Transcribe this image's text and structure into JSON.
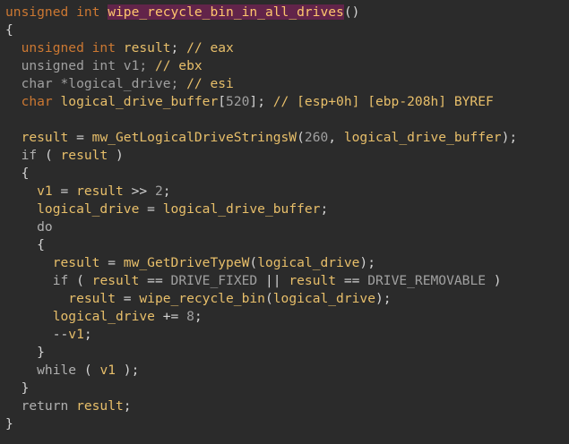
{
  "code": {
    "lines": [
      [
        {
          "t": "unsigned int ",
          "c": "type"
        },
        {
          "t": "wipe_recycle_bin_in_all_drives",
          "c": "func-hl"
        },
        {
          "t": "()",
          "c": "punct"
        }
      ],
      [
        {
          "t": "{",
          "c": "brace"
        }
      ],
      [
        {
          "t": "  unsigned int ",
          "c": "type"
        },
        {
          "t": "result",
          "c": "var"
        },
        {
          "t": "; ",
          "c": "punct"
        },
        {
          "t": "// eax",
          "c": "comment"
        }
      ],
      [
        {
          "t": "  unsigned int ",
          "c": "dim"
        },
        {
          "t": "v1",
          "c": "dim"
        },
        {
          "t": "; ",
          "c": "dim"
        },
        {
          "t": "// ebx",
          "c": "comment"
        }
      ],
      [
        {
          "t": "  char ",
          "c": "dim"
        },
        {
          "t": "*logical_drive",
          "c": "dim"
        },
        {
          "t": "; ",
          "c": "dim"
        },
        {
          "t": "// esi",
          "c": "comment"
        }
      ],
      [
        {
          "t": "  char ",
          "c": "type"
        },
        {
          "t": "logical_drive_buffer",
          "c": "var"
        },
        {
          "t": "[",
          "c": "punct"
        },
        {
          "t": "520",
          "c": "num"
        },
        {
          "t": "]; ",
          "c": "punct"
        },
        {
          "t": "// [esp+0h] [ebp-208h] BYREF",
          "c": "comment"
        }
      ],
      [],
      [
        {
          "t": "  result",
          "c": "var"
        },
        {
          "t": " = ",
          "c": "punct"
        },
        {
          "t": "mw_GetLogicalDriveStringsW",
          "c": "func"
        },
        {
          "t": "(",
          "c": "punct"
        },
        {
          "t": "260",
          "c": "num"
        },
        {
          "t": ", ",
          "c": "punct"
        },
        {
          "t": "logical_drive_buffer",
          "c": "var"
        },
        {
          "t": ");",
          "c": "punct"
        }
      ],
      [
        {
          "t": "  if",
          "c": "kw"
        },
        {
          "t": " ( ",
          "c": "punct"
        },
        {
          "t": "result",
          "c": "var"
        },
        {
          "t": " )",
          "c": "punct"
        }
      ],
      [
        {
          "t": "  {",
          "c": "brace"
        }
      ],
      [
        {
          "t": "    v1",
          "c": "var"
        },
        {
          "t": " = ",
          "c": "punct"
        },
        {
          "t": "result",
          "c": "var"
        },
        {
          "t": " >> ",
          "c": "punct"
        },
        {
          "t": "2",
          "c": "num"
        },
        {
          "t": ";",
          "c": "punct"
        }
      ],
      [
        {
          "t": "    logical_drive",
          "c": "var"
        },
        {
          "t": " = ",
          "c": "punct"
        },
        {
          "t": "logical_drive_buffer",
          "c": "var"
        },
        {
          "t": ";",
          "c": "punct"
        }
      ],
      [
        {
          "t": "    do",
          "c": "kw"
        }
      ],
      [
        {
          "t": "    {",
          "c": "brace"
        }
      ],
      [
        {
          "t": "      result",
          "c": "var"
        },
        {
          "t": " = ",
          "c": "punct"
        },
        {
          "t": "mw_GetDriveTypeW",
          "c": "func"
        },
        {
          "t": "(",
          "c": "punct"
        },
        {
          "t": "logical_drive",
          "c": "var"
        },
        {
          "t": ");",
          "c": "punct"
        }
      ],
      [
        {
          "t": "      if",
          "c": "kw"
        },
        {
          "t": " ( ",
          "c": "punct"
        },
        {
          "t": "result",
          "c": "var"
        },
        {
          "t": " == ",
          "c": "punct"
        },
        {
          "t": "DRIVE_FIXED",
          "c": "const"
        },
        {
          "t": " || ",
          "c": "punct"
        },
        {
          "t": "result",
          "c": "var"
        },
        {
          "t": " == ",
          "c": "punct"
        },
        {
          "t": "DRIVE_REMOVABLE",
          "c": "const"
        },
        {
          "t": " )",
          "c": "punct"
        }
      ],
      [
        {
          "t": "        result",
          "c": "var"
        },
        {
          "t": " = ",
          "c": "punct"
        },
        {
          "t": "wipe_recycle_bin",
          "c": "func"
        },
        {
          "t": "(",
          "c": "punct"
        },
        {
          "t": "logical_drive",
          "c": "var"
        },
        {
          "t": ");",
          "c": "punct"
        }
      ],
      [
        {
          "t": "      logical_drive",
          "c": "var"
        },
        {
          "t": " += ",
          "c": "punct"
        },
        {
          "t": "8",
          "c": "num"
        },
        {
          "t": ";",
          "c": "punct"
        }
      ],
      [
        {
          "t": "      --",
          "c": "punct"
        },
        {
          "t": "v1",
          "c": "var"
        },
        {
          "t": ";",
          "c": "punct"
        }
      ],
      [
        {
          "t": "    }",
          "c": "brace"
        }
      ],
      [
        {
          "t": "    while",
          "c": "kw"
        },
        {
          "t": " ( ",
          "c": "punct"
        },
        {
          "t": "v1",
          "c": "var"
        },
        {
          "t": " );",
          "c": "punct"
        }
      ],
      [
        {
          "t": "  }",
          "c": "brace"
        }
      ],
      [
        {
          "t": "  return ",
          "c": "kw"
        },
        {
          "t": "result",
          "c": "var"
        },
        {
          "t": ";",
          "c": "punct"
        }
      ],
      [
        {
          "t": "}",
          "c": "brace"
        }
      ]
    ]
  },
  "colors": {
    "background": "#2b2b2b",
    "type_keyword": "#cc7832",
    "identifier": "#e8bf6a",
    "highlighted_function_bg": "#62244a",
    "punctuation": "#d4d4d4"
  }
}
